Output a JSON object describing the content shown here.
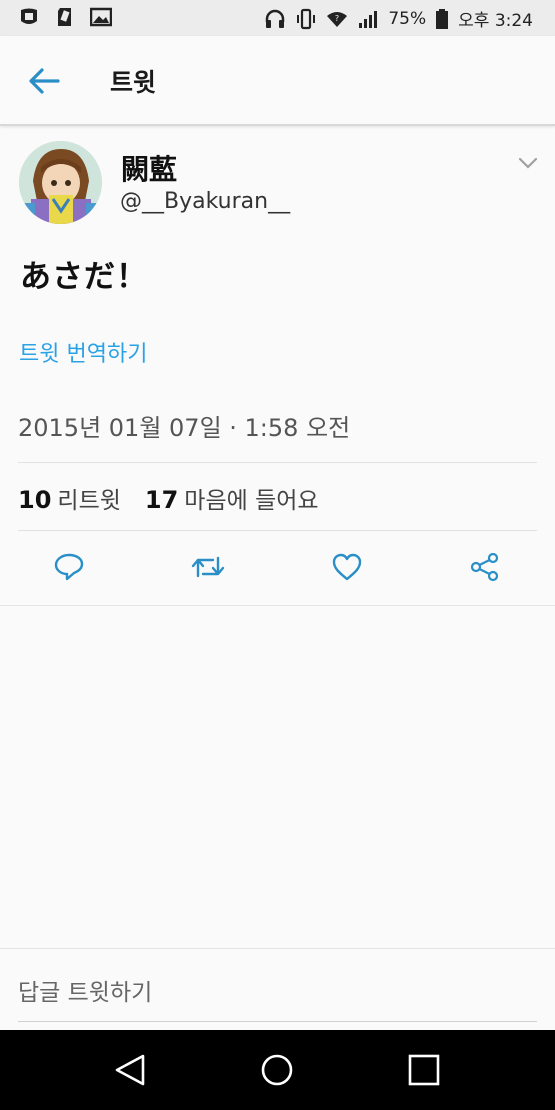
{
  "status_bar": {
    "battery": "75%",
    "time": "오후 3:24",
    "icons": [
      "app-icon",
      "sd-card-icon",
      "image-icon",
      "headphones-icon",
      "vibrate-icon",
      "wifi-icon",
      "signal-icon",
      "battery-icon"
    ]
  },
  "app_bar": {
    "title": "트윗"
  },
  "tweet": {
    "display_name": "闕藍",
    "handle": "@__Byakuran__",
    "text": "あさだ！",
    "translate_label": "트윗 번역하기",
    "timestamp": "2015년 01월 07일 · 1:58 오전",
    "retweet_count": "10",
    "retweet_label": "리트윗",
    "like_count": "17",
    "like_label": "마음에 들어요"
  },
  "reply": {
    "placeholder": "답글 트윗하기"
  },
  "colors": {
    "accent": "#2aa3e6",
    "icon": "#2a8fc7"
  }
}
